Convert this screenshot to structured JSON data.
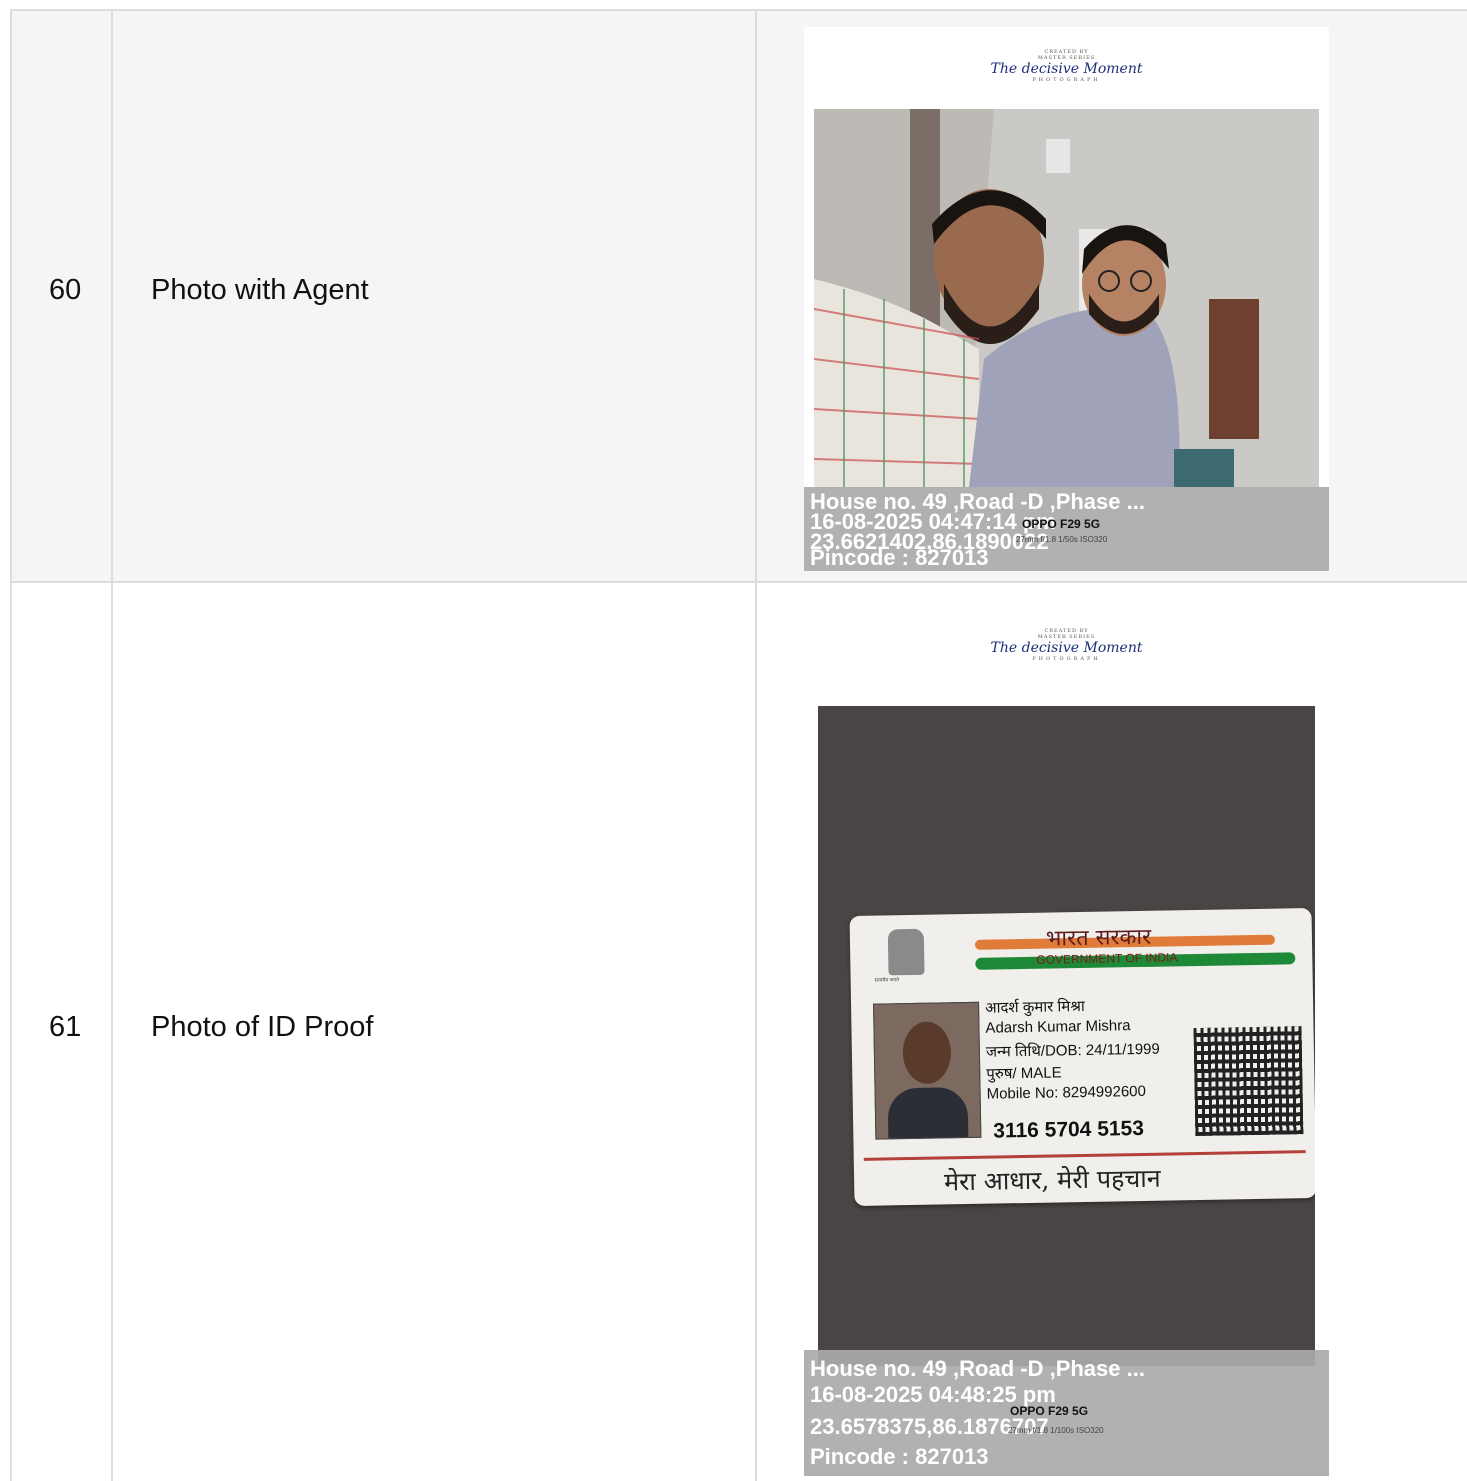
{
  "rows": [
    {
      "number": "60",
      "label": "Photo with Agent",
      "brand": {
        "created_by": "CREATED BY",
        "series": "MASTER SERIES",
        "script": "The decisive Moment",
        "sub": "PHOTOGRAPH"
      },
      "overlay": {
        "address": "House no. 49 ,Road -D ,Phase ...",
        "datetime": "16-08-2025 04:47:14 pm",
        "coords": "23.6621402,86.1890022",
        "pincode": "Pincode : 827013",
        "device": "OPPO F29 5G",
        "device_meta": "27mm f/1.8 1/50s ISO320"
      }
    },
    {
      "number": "61",
      "label": "Photo of ID Proof",
      "brand": {
        "created_by": "CREATED BY",
        "series": "MASTER SERIES",
        "script": "The decisive Moment",
        "sub": "PHOTOGRAPH"
      },
      "overlay": {
        "address": "House no. 49 ,Road -D ,Phase ...",
        "datetime": "16-08-2025 04:48:25 pm",
        "coords": "23.6578375,86.1876707",
        "pincode": "Pincode : 827013",
        "device": "OPPO F29 5G",
        "device_meta": "27mm f/1.8 1/100s ISO320"
      },
      "id_card": {
        "header_hindi": "भारत सरकार",
        "header_english": "GOVERNMENT OF INDIA",
        "emblem_caption": "सत्यमेव जयते",
        "name_hindi": "आदर्श कुमार मिश्रा",
        "name_english": "Adarsh Kumar Mishra",
        "dob": "जन्म तिथि/DOB: 24/11/1999",
        "gender": "पुरुष/ MALE",
        "mobile": "Mobile No: 8294992600",
        "aadhaar_number": "3116 5704 5153",
        "motto": "मेरा आधार, मेरी पहचान"
      }
    }
  ]
}
